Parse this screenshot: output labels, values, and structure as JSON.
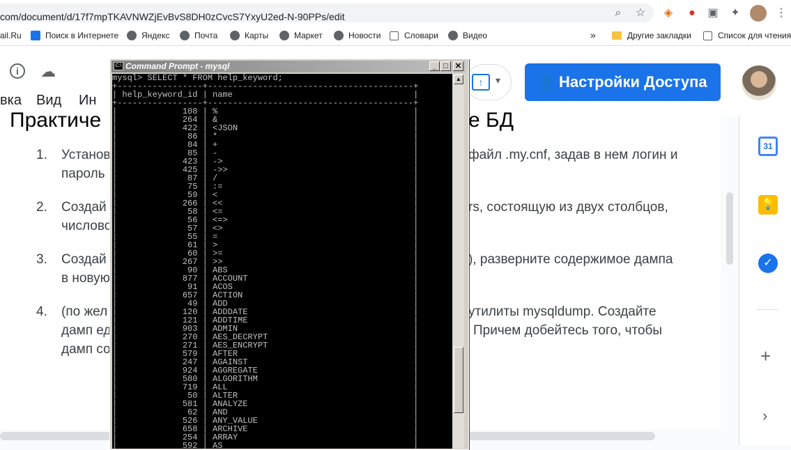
{
  "browser": {
    "url": "com/document/d/17f7mpTKAVNWZjEvBvS8DH0zCvcS7YxyU2ed-N-90PPs/edit",
    "bookmarks": [
      "ail.Ru",
      "Поиск в Интернете",
      "Яндекс",
      "Почта",
      "Карты",
      "Маркет",
      "Новости",
      "Словари",
      "Видео"
    ],
    "other_bookmarks": "Другие закладки",
    "reading_list": "Список для чтения",
    "more": "»"
  },
  "docs": {
    "menu": [
      "вка",
      "Вид",
      "Ин"
    ],
    "share_label": "Настройки Доступа",
    "heading_left": "Практиче",
    "heading_right": "е БД",
    "items": [
      {
        "num": "1.",
        "line1_left": "Установ",
        "line1_right": "файл .my.cnf, задав в нем логин и",
        "line2": "пароль"
      },
      {
        "num": "2.",
        "line1_left": "Создай",
        "line1_right": "rs, состоящую из двух столбцов,",
        "line2": "числово"
      },
      {
        "num": "3.",
        "line1_left": "Создай",
        "line1_right": "), разверните содержимое дампа",
        "line2": "в новую"
      },
      {
        "num": "4.",
        "line1_left": "(по жел",
        "line1_right": "утилиты mysqldump. Создайте",
        "line2": "дамп ед",
        "line2_right": "Причем добейтесь того, чтобы",
        "line3": "дамп со"
      }
    ]
  },
  "side_icons": [
    "calendar-icon",
    "keep-icon",
    "tasks-icon",
    "add-icon",
    "expand-icon"
  ],
  "cmd": {
    "title": "Command Prompt - mysql",
    "prompt": "mysql> SELECT * FROM help_keyword;",
    "columns": [
      "help_keyword_id",
      "name"
    ],
    "rows": [
      [
        "108",
        "%"
      ],
      [
        "264",
        "&"
      ],
      [
        "422",
        "<JSON"
      ],
      [
        "86",
        "*"
      ],
      [
        "84",
        "+"
      ],
      [
        "85",
        "-"
      ],
      [
        "423",
        "->"
      ],
      [
        "425",
        "->>"
      ],
      [
        "87",
        "/"
      ],
      [
        "75",
        ":="
      ],
      [
        "59",
        "<"
      ],
      [
        "266",
        "<<"
      ],
      [
        "58",
        "<="
      ],
      [
        "56",
        "<=>"
      ],
      [
        "57",
        "<>"
      ],
      [
        "55",
        "="
      ],
      [
        "61",
        ">"
      ],
      [
        "60",
        ">="
      ],
      [
        "267",
        ">>"
      ],
      [
        "90",
        "ABS"
      ],
      [
        "877",
        "ACCOUNT"
      ],
      [
        "91",
        "ACOS"
      ],
      [
        "657",
        "ACTION"
      ],
      [
        "49",
        "ADD"
      ],
      [
        "120",
        "ADDDATE"
      ],
      [
        "121",
        "ADDTIME"
      ],
      [
        "903",
        "ADMIN"
      ],
      [
        "270",
        "AES_DECRYPT"
      ],
      [
        "271",
        "AES_ENCRYPT"
      ],
      [
        "579",
        "AFTER"
      ],
      [
        "247",
        "AGAINST"
      ],
      [
        "924",
        "AGGREGATE"
      ],
      [
        "580",
        "ALGORITHM"
      ],
      [
        "719",
        "ALL"
      ],
      [
        "50",
        "ALTER"
      ],
      [
        "581",
        "ANALYZE"
      ],
      [
        "62",
        "AND"
      ],
      [
        "526",
        "ANY_VALUE"
      ],
      [
        "658",
        "ARCHIVE"
      ],
      [
        "254",
        "ARRAY"
      ],
      [
        "592",
        "AS"
      ]
    ]
  }
}
